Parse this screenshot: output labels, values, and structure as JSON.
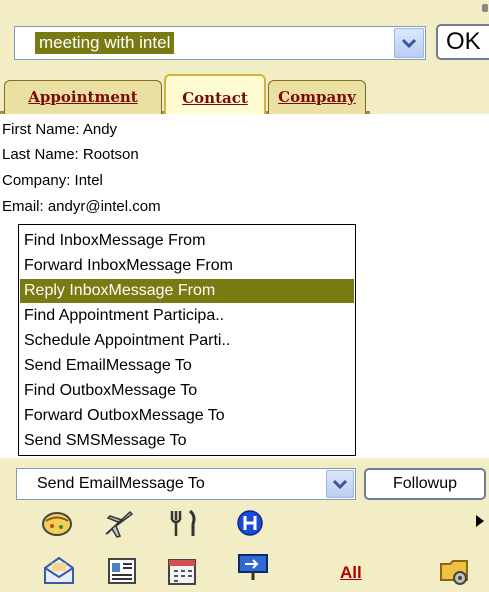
{
  "search": {
    "value": "meeting with intel",
    "ok_label": "OK"
  },
  "tabs": [
    {
      "label": "Appointment",
      "active": false
    },
    {
      "label": "Contact",
      "active": true
    },
    {
      "label": "Company",
      "active": false
    }
  ],
  "contact": {
    "first_name": "First Name: Andy",
    "last_name": "Last Name: Rootson",
    "company": "Company: Intel",
    "email": "Email: andyr@intel.com"
  },
  "actions": {
    "items": [
      "Find InboxMessage From",
      "Forward InboxMessage From",
      "Reply InboxMessage From",
      "Find Appointment Participa..",
      "Schedule Appointment Parti..",
      "Send EmailMessage To",
      "Find OutboxMessage To",
      "Forward OutboxMessage To",
      "Send SMSMessage To"
    ],
    "selected_index": 2,
    "selected_value": "Send EmailMessage To",
    "followup_label": "Followup"
  },
  "toolbar": {
    "row1_icons": [
      "food-icon",
      "airplane-icon",
      "utensils-icon",
      "hotel-icon"
    ],
    "row2_icons": [
      "mail-icon",
      "contacts-icon",
      "calendar-icon",
      "tasks-icon",
      "folder-settings-icon"
    ],
    "all_label": "All"
  },
  "colors": {
    "accent_selection": "#7a7a12",
    "panel_background": "#f3edc6",
    "tab_text": "#7a0a0a",
    "all_link": "#b00000"
  }
}
